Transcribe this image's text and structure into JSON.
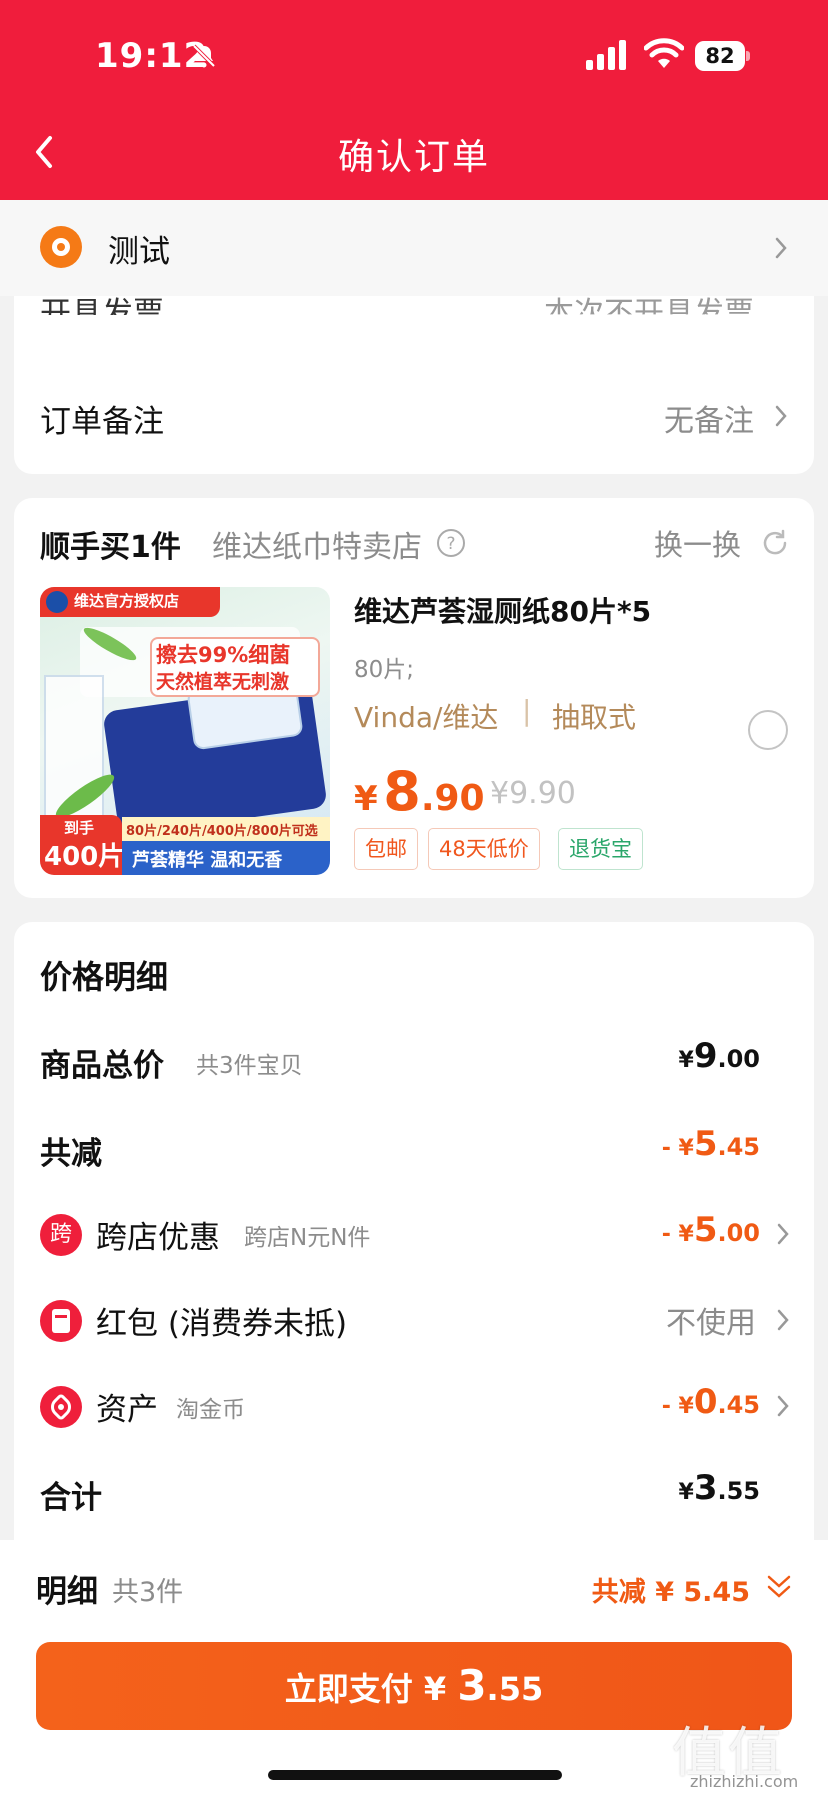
{
  "status_bar": {
    "time": "19:12",
    "battery": "82"
  },
  "nav": {
    "title": "确认订单"
  },
  "address": {
    "name": "测试"
  },
  "order_options": {
    "invoice_label": "开具发票",
    "invoice_value": "本次不开具发票",
    "note_label": "订单备注",
    "note_value": "无备注"
  },
  "addon": {
    "title": "顺手买1件",
    "shop": "维达纸巾特卖店",
    "swap_label": "换一换",
    "product": {
      "name": "维达芦荟湿厕纸80片*5",
      "spec": "80片;",
      "brand": "Vinda/维达",
      "type": "抽取式",
      "price_symbol": "¥",
      "price_int": "8",
      "price_dec": ".90",
      "original_price": "¥9.90",
      "tags": [
        "包邮",
        "48天低价",
        "退货宝"
      ],
      "image_texts": {
        "store_badge": "维达官方授权店",
        "headline1": "擦去99%细菌",
        "headline2": "天然植萃无刺激",
        "corner1": "到手",
        "corner2": "400片",
        "options": "80片/240片/400片/800片可选",
        "slogan": "芦荟精华 温和无香"
      }
    }
  },
  "price_detail": {
    "title": "价格明细",
    "rows": [
      {
        "label": "商品总价",
        "sub": "共3件宝贝",
        "prefix": "¥",
        "int": "9",
        "dec": ".00"
      },
      {
        "label": "共减",
        "sub": "",
        "prefix": "- ¥",
        "int": "5",
        "dec": ".45"
      },
      {
        "label": "跨店优惠",
        "sub": "跨店N元N件",
        "prefix": "- ¥",
        "int": "5",
        "dec": ".00",
        "icon_text": "跨"
      },
      {
        "label": "红包 (消费券未抵)",
        "sub": "",
        "value": "不使用"
      },
      {
        "label": "资产",
        "sub": "淘金币",
        "prefix": "- ¥",
        "int": "0",
        "dec": ".45"
      },
      {
        "label": "合计",
        "sub": "",
        "prefix": "¥",
        "int": "3",
        "dec": ".55"
      }
    ]
  },
  "summary": {
    "label": "明细",
    "count": "共3件",
    "discount": "共减 ¥ 5.45"
  },
  "pay_button": {
    "prefix": "立即支付 ¥ ",
    "amount_int": "3",
    "amount_dec": ".55"
  },
  "watermark": {
    "main": "值值值",
    "sub": "zhizhizhi.com"
  },
  "colors": {
    "header": "#f01d3c",
    "accent": "#f05a14"
  }
}
